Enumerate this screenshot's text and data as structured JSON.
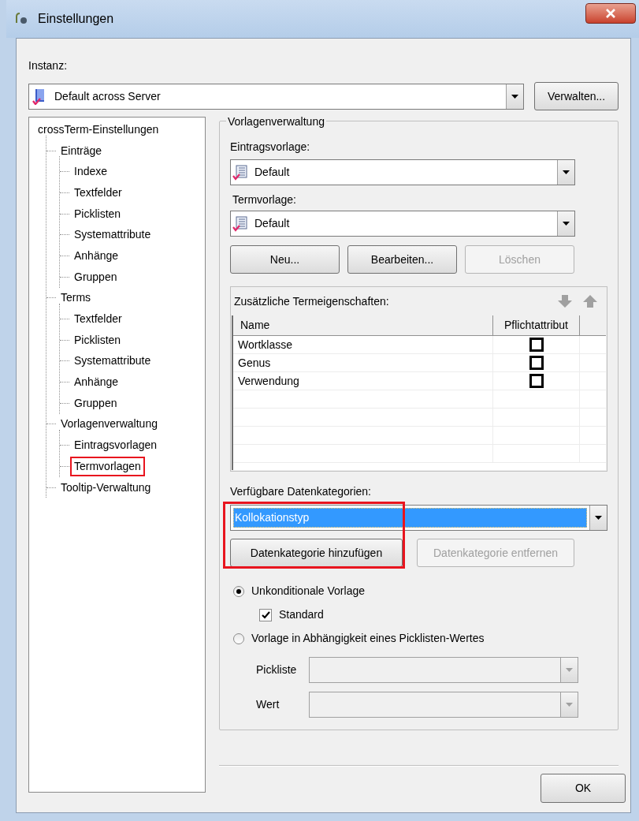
{
  "window": {
    "title": "Einstellungen"
  },
  "instance": {
    "label": "Instanz:",
    "value": "Default across Server",
    "manage_button": "Verwalten..."
  },
  "tree": [
    {
      "label": "crossTerm-Einstellungen",
      "highlighted": false,
      "children": [
        {
          "label": "Einträge",
          "highlighted": false,
          "children": [
            {
              "label": "Indexe",
              "highlighted": false
            },
            {
              "label": "Textfelder",
              "highlighted": false
            },
            {
              "label": "Picklisten",
              "highlighted": false
            },
            {
              "label": "Systemattribute",
              "highlighted": false
            },
            {
              "label": "Anhänge",
              "highlighted": false
            },
            {
              "label": "Gruppen",
              "highlighted": false
            }
          ]
        },
        {
          "label": "Terms",
          "highlighted": false,
          "children": [
            {
              "label": "Textfelder",
              "highlighted": false
            },
            {
              "label": "Picklisten",
              "highlighted": false
            },
            {
              "label": "Systemattribute",
              "highlighted": false
            },
            {
              "label": "Anhänge",
              "highlighted": false
            },
            {
              "label": "Gruppen",
              "highlighted": false
            }
          ]
        },
        {
          "label": "Vorlagenverwaltung",
          "highlighted": false,
          "children": [
            {
              "label": "Eintragsvorlagen",
              "highlighted": false
            },
            {
              "label": "Termvorlagen",
              "highlighted": true
            }
          ]
        },
        {
          "label": "Tooltip-Verwaltung",
          "highlighted": false
        }
      ]
    }
  ],
  "templates": {
    "legend": "Vorlagenverwaltung",
    "entry_template": {
      "label": "Eintragsvorlage:",
      "value": "Default"
    },
    "term_template": {
      "label": "Termvorlage:",
      "value": "Default"
    },
    "buttons": [
      {
        "label": "Neu...",
        "disabled": false
      },
      {
        "label": "Bearbeiten...",
        "disabled": false
      },
      {
        "label": "Löschen",
        "disabled": true
      }
    ]
  },
  "term_properties": {
    "title": "Zusätzliche Termeigenschaften:",
    "columns": [
      "Name",
      "Pflichtattribut"
    ],
    "rows": [
      {
        "name": "Wortklasse",
        "required": false
      },
      {
        "name": "Genus",
        "required": false
      },
      {
        "name": "Verwendung",
        "required": false
      }
    ]
  },
  "data_categories": {
    "label": "Verfügbare Datenkategorien:",
    "value": "Kollokationstyp",
    "highlighted": true,
    "buttons": [
      {
        "label": "Datenkategorie hinzufügen",
        "disabled": false
      },
      {
        "label": "Datenkategorie entfernen",
        "disabled": true
      }
    ]
  },
  "conditions": [
    {
      "kind": "radio",
      "label": "Unkonditionale Vorlage",
      "selected": true
    },
    {
      "kind": "checkbox",
      "label": "Standard",
      "checked": true
    },
    {
      "kind": "radio",
      "label": "Vorlage in Abhängigkeit eines Picklisten-Wertes",
      "selected": false
    }
  ],
  "fields": [
    {
      "label": "Pickliste",
      "disabled": true
    },
    {
      "label": "Wert",
      "disabled": true
    }
  ],
  "ok_button": "OK"
}
